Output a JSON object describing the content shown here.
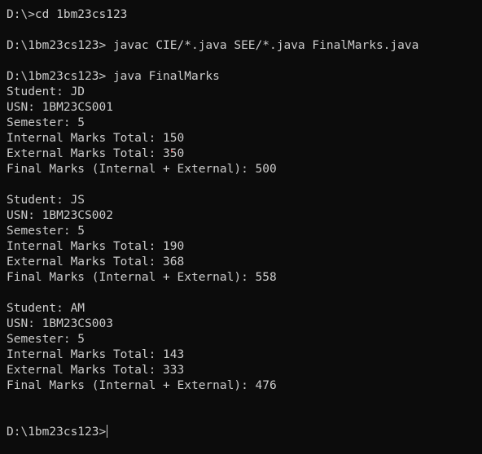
{
  "terminal": {
    "commands": [
      "D:\\>cd 1bm23cs123",
      "D:\\1bm23cs123> javac CIE/*.java SEE/*.java FinalMarks.java",
      "D:\\1bm23cs123> java FinalMarks"
    ],
    "students": [
      {
        "student": "Student: JD",
        "usn": "USN: 1BM23CS001",
        "semester": "Semester: 5",
        "internal": "Internal Marks Total: 150",
        "external": "External Marks Total: 350",
        "final": "Final Marks (Internal + External): 500"
      },
      {
        "student": "Student: JS",
        "usn": "USN: 1BM23CS002",
        "semester": "Semester: 5",
        "internal": "Internal Marks Total: 190",
        "external": "External Marks Total: 368",
        "final": "Final Marks (Internal + External): 558"
      },
      {
        "student": "Student: AM",
        "usn": "USN: 1BM23CS003",
        "semester": "Semester: 5",
        "internal": "Internal Marks Total: 143",
        "external": "External Marks Total: 333",
        "final": "Final Marks (Internal + External): 476"
      }
    ],
    "prompt": "D:\\1bm23cs123>"
  }
}
